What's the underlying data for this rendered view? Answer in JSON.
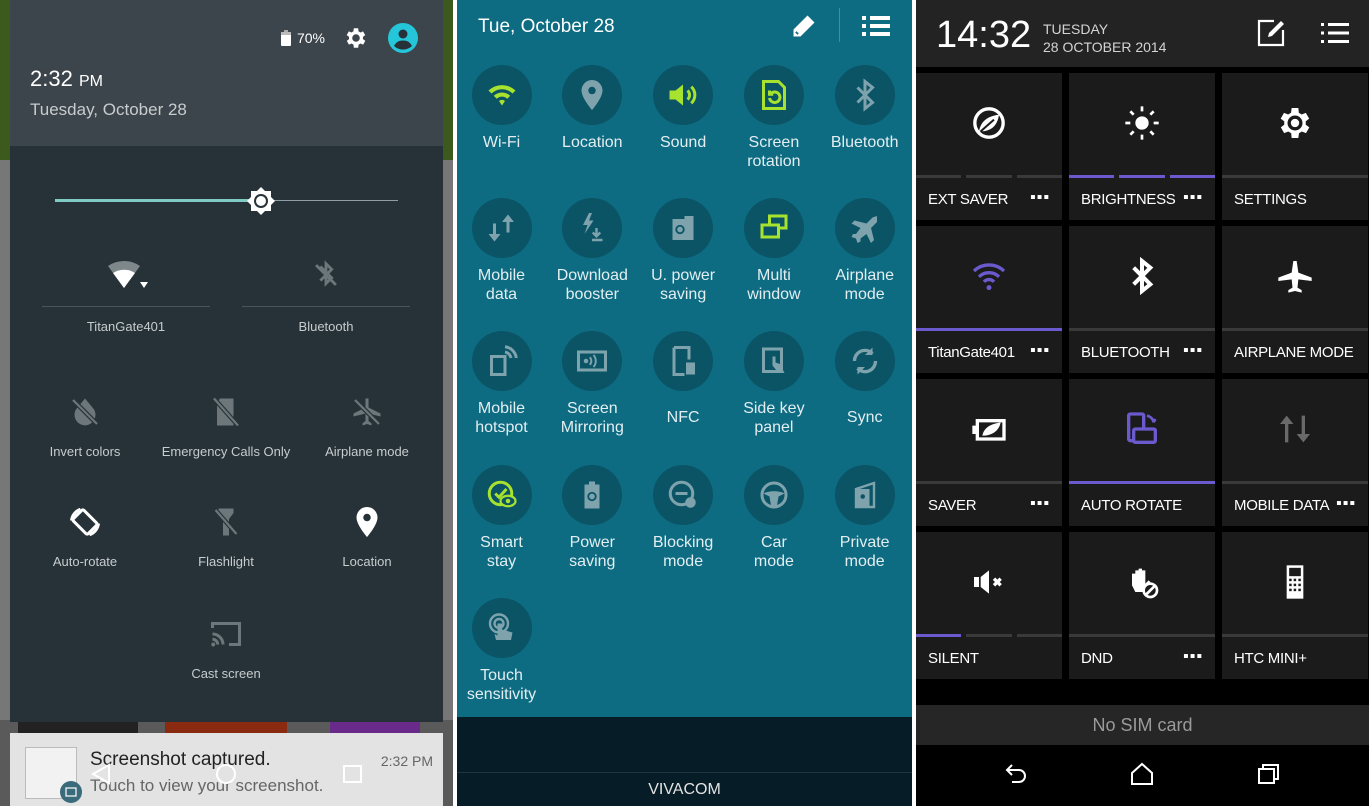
{
  "panel_stock": {
    "battery": "70%",
    "time": "2:32",
    "ampm": "PM",
    "date": "Tuesday, October 28",
    "brightness_level": 0.6,
    "wifi_label": "TitanGate401",
    "bluetooth_label": "Bluetooth",
    "tiles": [
      {
        "label": "Invert colors",
        "icon": "invert-colors-off-icon"
      },
      {
        "label": "Emergency Calls Only",
        "icon": "no-sim-icon"
      },
      {
        "label": "Airplane mode",
        "icon": "airplane-off-icon"
      },
      {
        "label": "Auto-rotate",
        "icon": "auto-rotate-icon"
      },
      {
        "label": "Flashlight",
        "icon": "flashlight-off-icon"
      },
      {
        "label": "Location",
        "icon": "location-icon"
      },
      {
        "label": "Cast screen",
        "icon": "cast-icon"
      }
    ],
    "notification": {
      "title": "Screenshot captured.",
      "subtitle": "Touch to view your screenshot.",
      "time": "2:32 PM"
    }
  },
  "panel_samsung": {
    "date": "Tue, October 28",
    "accent_on": "#a6e22e",
    "tiles": [
      {
        "label1": "Wi-Fi",
        "label2": "",
        "on": true
      },
      {
        "label1": "Location",
        "label2": "",
        "on": false
      },
      {
        "label1": "Sound",
        "label2": "",
        "on": true
      },
      {
        "label1": "Screen",
        "label2": "rotation",
        "on": true
      },
      {
        "label1": "Bluetooth",
        "label2": "",
        "on": false
      },
      {
        "label1": "Mobile",
        "label2": "data",
        "on": false
      },
      {
        "label1": "Download",
        "label2": "booster",
        "on": false
      },
      {
        "label1": "U. power",
        "label2": "saving",
        "on": false
      },
      {
        "label1": "Multi",
        "label2": "window",
        "on": true
      },
      {
        "label1": "Airplane",
        "label2": "mode",
        "on": false
      },
      {
        "label1": "Mobile",
        "label2": "hotspot",
        "on": false
      },
      {
        "label1": "Screen",
        "label2": "Mirroring",
        "on": false
      },
      {
        "label1": "NFC",
        "label2": "",
        "on": false
      },
      {
        "label1": "Side key",
        "label2": "panel",
        "on": false
      },
      {
        "label1": "Sync",
        "label2": "",
        "on": false
      },
      {
        "label1": "Smart",
        "label2": "stay",
        "on": true
      },
      {
        "label1": "Power",
        "label2": "saving",
        "on": false
      },
      {
        "label1": "Blocking",
        "label2": "mode",
        "on": false
      },
      {
        "label1": "Car",
        "label2": "mode",
        "on": false
      },
      {
        "label1": "Private",
        "label2": "mode",
        "on": false
      },
      {
        "label1": "Touch",
        "label2": "sensitivity",
        "on": false
      }
    ],
    "carrier": "VIVACOM"
  },
  "panel_htc": {
    "time": "14:32",
    "day": "TUESDAY",
    "date": "28 OCTOBER 2014",
    "accent": "#6a5acd",
    "more": "▪▪▪",
    "tiles": [
      {
        "label": "EXT SAVER",
        "more": true
      },
      {
        "label": "BRIGHTNESS",
        "more": true
      },
      {
        "label": "SETTINGS",
        "more": false
      },
      {
        "label": "TitanGate401",
        "more": true
      },
      {
        "label": "BLUETOOTH",
        "more": true
      },
      {
        "label": "AIRPLANE MODE",
        "more": false
      },
      {
        "label": "SAVER",
        "more": true
      },
      {
        "label": "AUTO ROTATE",
        "more": false
      },
      {
        "label": "MOBILE DATA",
        "more": true
      },
      {
        "label": "SILENT",
        "more": false
      },
      {
        "label": "DND",
        "more": true
      },
      {
        "label": "HTC MINI+",
        "more": false
      }
    ],
    "sim_status": "No SIM card"
  }
}
